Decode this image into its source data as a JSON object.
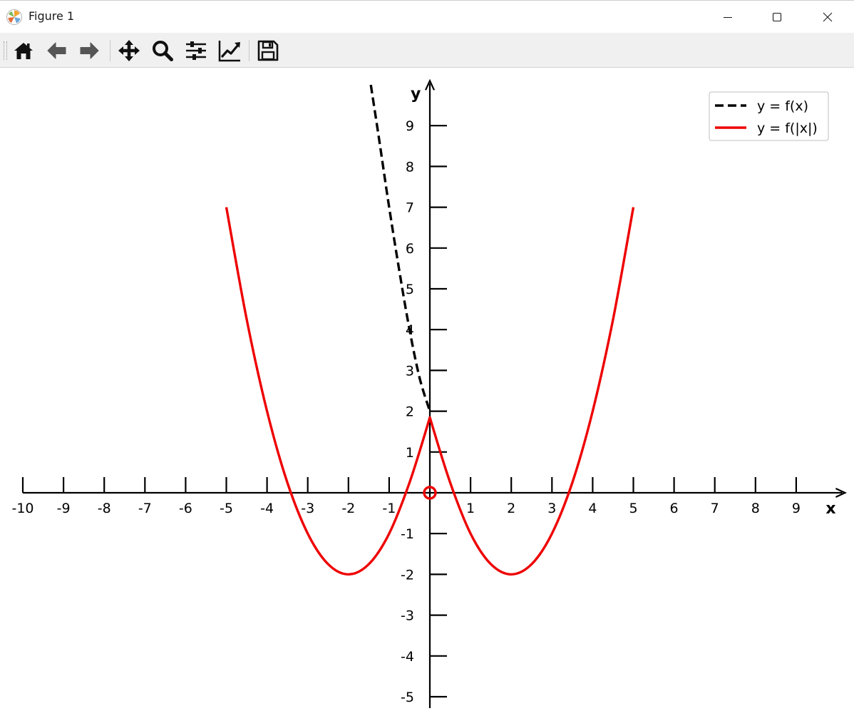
{
  "window": {
    "title": "Figure 1",
    "icon": "matplotlib-icon",
    "controls": [
      "minimize-icon",
      "maximize-icon",
      "close-icon"
    ]
  },
  "toolbar": {
    "tools": [
      {
        "name": "home-icon"
      },
      {
        "name": "back-arrow-icon"
      },
      {
        "name": "forward-arrow-icon"
      },
      {
        "name": "pan-icon"
      },
      {
        "name": "zoom-icon"
      },
      {
        "name": "configure-subplots-icon"
      },
      {
        "name": "edit-axis-icon"
      },
      {
        "name": "save-icon"
      }
    ]
  },
  "chart_data": {
    "type": "line",
    "xlabel": "x",
    "ylabel": "y",
    "xlim": [
      -10,
      10.2
    ],
    "ylim": [
      -5.4,
      10.1
    ],
    "xticks": [
      -10,
      -9,
      -8,
      -7,
      -6,
      -5,
      -4,
      -3,
      -2,
      -1,
      1,
      2,
      3,
      4,
      5,
      6,
      7,
      8,
      9
    ],
    "yticks": [
      -5,
      -4,
      -3,
      -2,
      -1,
      1,
      2,
      3,
      4,
      5,
      6,
      7,
      8,
      9
    ],
    "grid": false,
    "legend": "top-right",
    "series": [
      {
        "name": "y = f(x)",
        "style": "dashed",
        "color": "#000000",
        "x": [
          -1.45,
          -1.25,
          -1.0,
          -0.75,
          -0.5,
          -0.25,
          0.0
        ],
        "y": [
          10.0,
          8.69,
          7.0,
          5.44,
          4.0,
          2.81,
          2.0
        ]
      },
      {
        "name": "y = f(|x|)",
        "style": "solid",
        "color": "#ee0000",
        "x": [
          -5,
          -4.5,
          -4,
          -3.5,
          -3,
          -2.5,
          -2,
          -1.5,
          -1,
          -0.5,
          0,
          0.5,
          1,
          1.5,
          2,
          2.5,
          3,
          3.5,
          4,
          4.5,
          5
        ],
        "y": [
          7.0,
          4.25,
          2.0,
          0.25,
          -1.0,
          -1.75,
          -2.0,
          -1.75,
          -1.0,
          0.25,
          1.85,
          0.25,
          -1.0,
          -1.75,
          -2.0,
          -1.75,
          -1.0,
          0.25,
          2.0,
          4.25,
          7.0
        ]
      }
    ],
    "annotations": [
      {
        "type": "open-circle",
        "x": 0,
        "y": 0,
        "color": "#ee0000"
      }
    ]
  }
}
